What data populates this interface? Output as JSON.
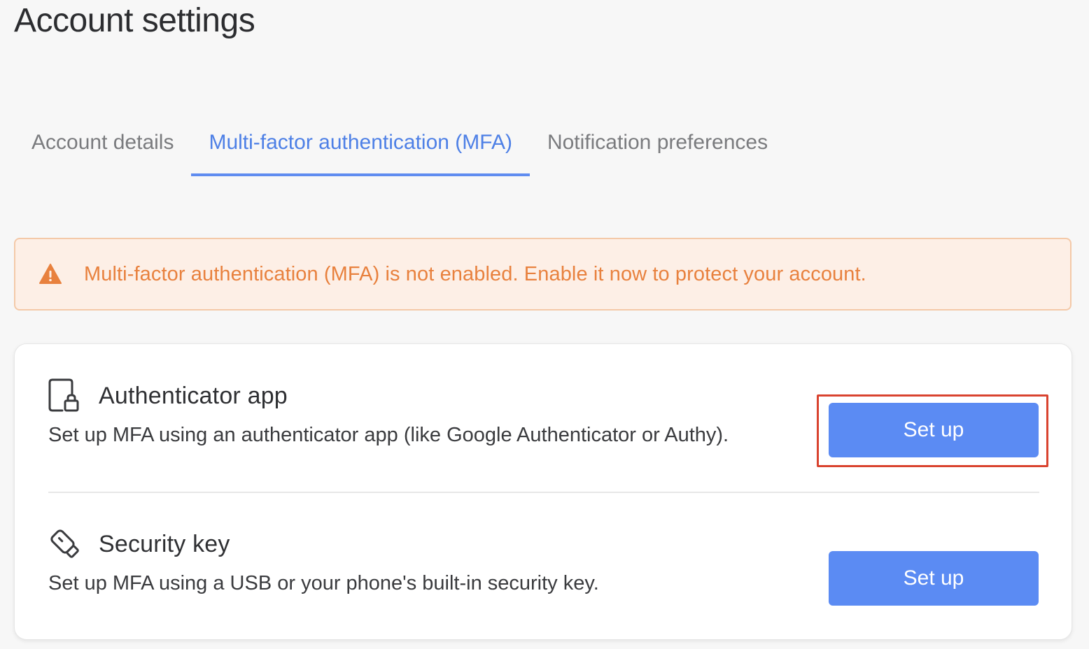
{
  "page": {
    "title": "Account settings"
  },
  "tabs": [
    {
      "label": "Account details",
      "active": false
    },
    {
      "label": "Multi-factor authentication (MFA)",
      "active": true
    },
    {
      "label": "Notification preferences",
      "active": false
    }
  ],
  "alert": {
    "icon": "warning-icon",
    "text": "Multi-factor authentication (MFA) is not enabled. Enable it now to protect your account.",
    "color": "#e8813e",
    "background": "#fdefe6"
  },
  "methods": [
    {
      "icon": "phone-lock-icon",
      "title": "Authenticator app",
      "description": "Set up MFA using an authenticator app (like Google Authenticator or Authy).",
      "button_label": "Set up",
      "highlighted": true
    },
    {
      "icon": "usb-key-icon",
      "title": "Security key",
      "description": "Set up MFA using a USB or your phone's built-in security key.",
      "button_label": "Set up",
      "highlighted": false
    }
  ],
  "colors": {
    "accent": "#5b8bf3",
    "active_tab": "#4e80e6",
    "highlight_box": "#d9432f"
  }
}
